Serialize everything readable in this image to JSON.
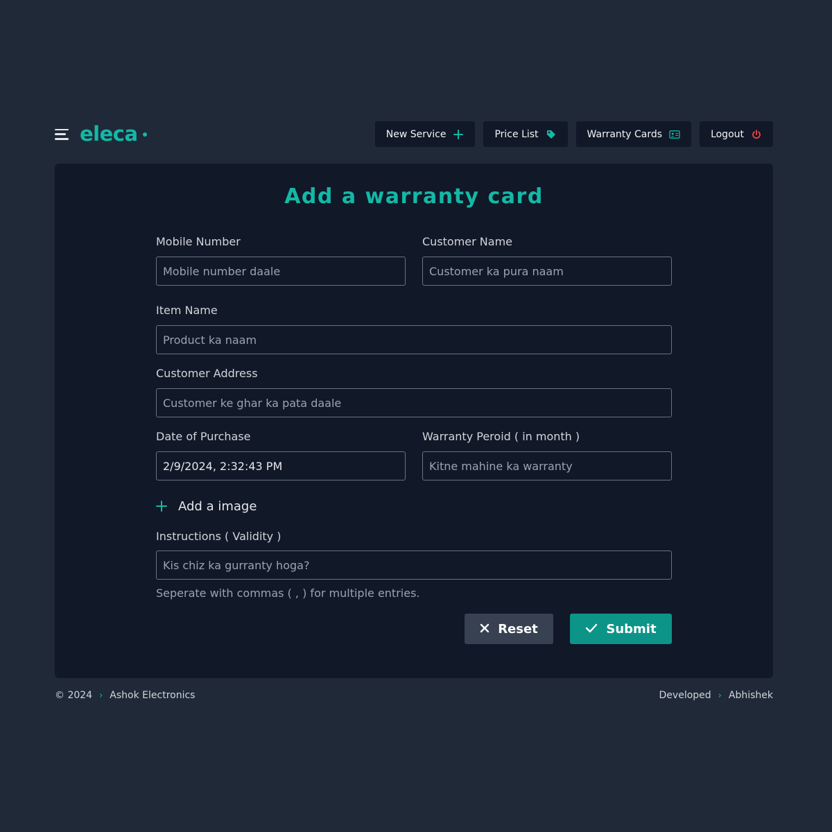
{
  "header": {
    "logo": "eleca",
    "nav": [
      {
        "label": "New Service",
        "icon": "plus-icon"
      },
      {
        "label": "Price List",
        "icon": "tag-icon"
      },
      {
        "label": "Warranty Cards",
        "icon": "id-card-icon"
      },
      {
        "label": "Logout",
        "icon": "power-icon"
      }
    ]
  },
  "form": {
    "title": "Add a warranty card",
    "mobile": {
      "label": "Mobile Number",
      "placeholder": "Mobile number daale",
      "value": ""
    },
    "customer_name": {
      "label": "Customer Name",
      "placeholder": "Customer ka pura naam",
      "value": ""
    },
    "item_name": {
      "label": "Item Name",
      "placeholder": "Product ka naam",
      "value": ""
    },
    "address": {
      "label": "Customer Address",
      "placeholder": "Customer ke ghar ka pata daale",
      "value": ""
    },
    "date": {
      "label": "Date of Purchase",
      "value": "2/9/2024, 2:32:43 PM"
    },
    "warranty_period": {
      "label": "Warranty Peroid ( in month )",
      "placeholder": "Kitne mahine ka warranty",
      "value": ""
    },
    "add_image": "Add a image",
    "instructions": {
      "label": "Instructions ( Validity )",
      "placeholder": "Kis chiz ka gurranty hoga?",
      "value": ""
    },
    "hint": "Seperate with commas ( , ) for multiple entries.",
    "reset_label": "Reset",
    "submit_label": "Submit"
  },
  "footer": {
    "copyright": "© 2024",
    "company": "Ashok Electronics",
    "developed": "Developed",
    "developer": "Abhishek"
  },
  "colors": {
    "accent": "#14b8a6",
    "background": "#1f2937",
    "card": "#111827",
    "logout_icon": "#ef4444"
  }
}
